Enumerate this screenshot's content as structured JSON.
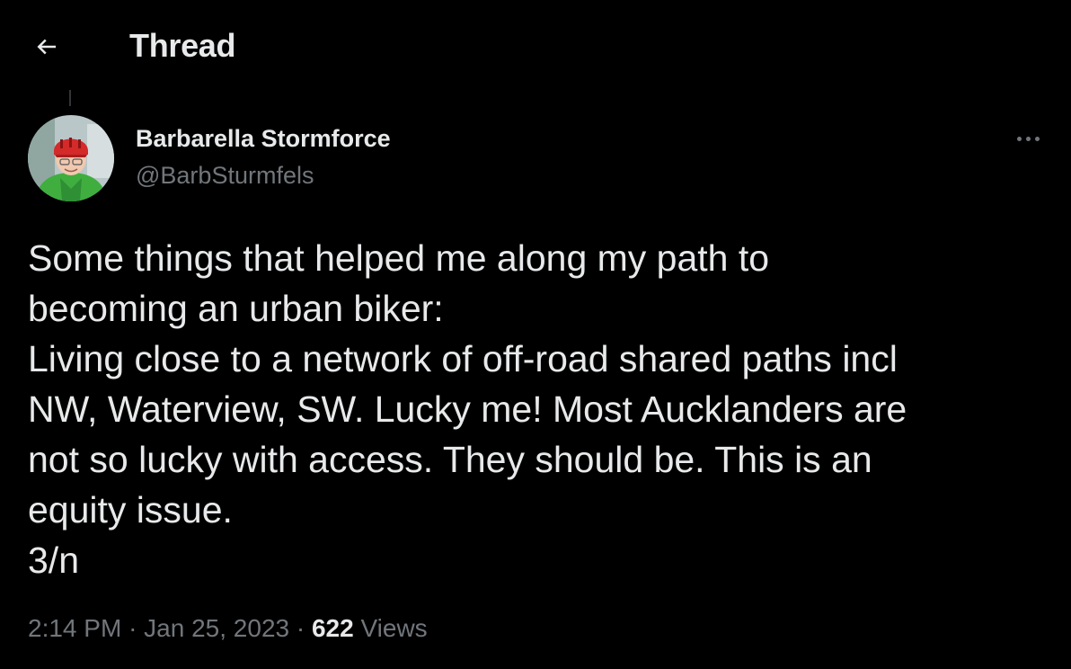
{
  "header": {
    "back_icon": "arrow-left-icon",
    "title": "Thread"
  },
  "tweet": {
    "author": {
      "display_name": "Barbarella Stormforce",
      "handle": "@BarbSturmfels",
      "avatar_icon": "profile-photo"
    },
    "more_icon": "more-horizontal-icon",
    "lines": [
      "Some things that helped me along my path to",
      "becoming an urban biker:",
      "Living close to a network of off-road shared paths incl",
      "NW, Waterview, SW. Lucky me! Most Aucklanders are",
      "not so lucky with access. They should be. This is an",
      "equity issue.",
      "3/n"
    ],
    "time": "2:14 PM",
    "separator": "·",
    "date": "Jan 25, 2023",
    "views_count": "622",
    "views_label": "Views"
  },
  "colors": {
    "background": "#000000",
    "primary_text": "#e7e9ea",
    "secondary_text": "#71767b",
    "helmet_red": "#d42a2a",
    "jacket_green": "#3fae3f"
  }
}
